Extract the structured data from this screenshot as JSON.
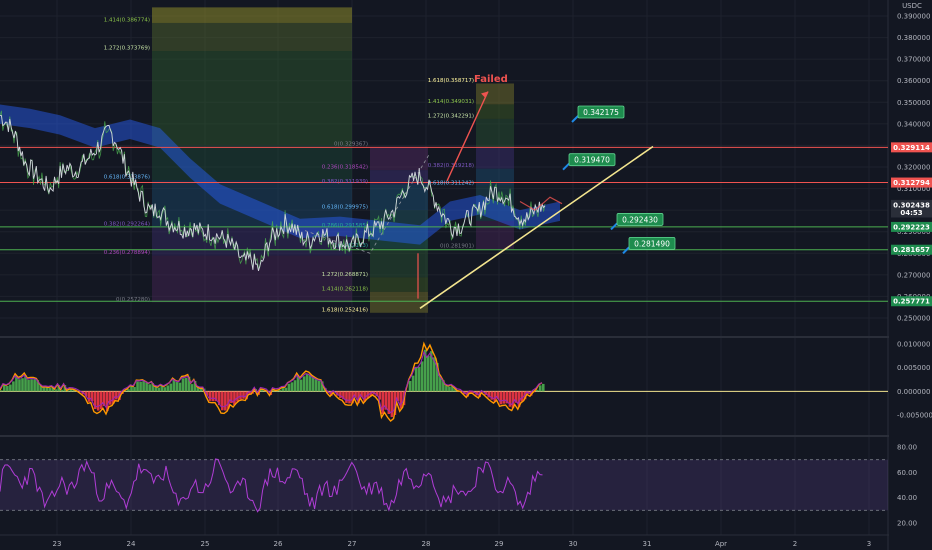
{
  "currency": "USDC",
  "colors": {
    "background": "#131722",
    "red_line": "#ef5350",
    "green_line": "#4caf50",
    "yellow_line": "#f3e58f",
    "purple_rsi": "#b03dd6",
    "macd_orange": "#ff9800",
    "macd_purple": "#9c27b0",
    "cloud_blue": "#2962ff",
    "callout_green": "#1e8c4e"
  },
  "price_axis": {
    "ticks": [
      "0.390000",
      "0.380000",
      "0.370000",
      "0.360000",
      "0.350000",
      "0.340000",
      "0.330000",
      "0.320000",
      "0.310000",
      "0.300000",
      "0.290000",
      "0.280000",
      "0.270000",
      "0.260000",
      "0.250000"
    ],
    "range": [
      0.247,
      0.3935
    ]
  },
  "price_labels": [
    {
      "text": "0.329114",
      "price": 0.329114,
      "color": "#ef5350"
    },
    {
      "text": "0.312794",
      "price": 0.312794,
      "color": "#ef5350"
    },
    {
      "text": "0.302438",
      "price": 0.302438,
      "color": "#2a2e39"
    },
    {
      "text": "04:53",
      "price": 0.2989,
      "color": "#2a2e39"
    },
    {
      "text": "0.292223",
      "price": 0.292223,
      "color": "#1e8c4e"
    },
    {
      "text": "0.281657",
      "price": 0.281657,
      "color": "#1e8c4e"
    },
    {
      "text": "0.257771",
      "price": 0.257771,
      "color": "#1e8c4e"
    }
  ],
  "horizontal_lines": [
    {
      "price": 0.329114,
      "color": "#ef5350"
    },
    {
      "price": 0.312794,
      "color": "#ef5350"
    },
    {
      "price": 0.292223,
      "color": "#4caf50"
    },
    {
      "price": 0.281657,
      "color": "#4caf50"
    },
    {
      "price": 0.257771,
      "color": "#4caf50"
    }
  ],
  "callouts": [
    {
      "text": "0.342175",
      "price": 0.3455
    },
    {
      "text": "0.319470",
      "price": 0.3234
    },
    {
      "text": "0.292430",
      "price": 0.2957
    },
    {
      "text": "0.281490",
      "price": 0.2846
    }
  ],
  "annotation_failed": "Failed",
  "fib_labels_left": [
    {
      "text": "1.414(0.386774)",
      "price": 0.386774,
      "color": "#8bc34a"
    },
    {
      "text": "1.272(0.373769)",
      "price": 0.373769,
      "color": "#c5e1a5"
    },
    {
      "text": "0.618(0.313876)",
      "price": 0.313876,
      "color": "#64b5f6"
    },
    {
      "text": "0.382(0.292264)",
      "price": 0.292264,
      "color": "#7e57c2"
    },
    {
      "text": "0.236(0.278894)",
      "price": 0.278894,
      "color": "#ab47bc"
    },
    {
      "text": "0(0.257280)",
      "price": 0.25728,
      "color": "#787b86"
    }
  ],
  "fib_labels_mid": [
    {
      "text": "0(0.329367)",
      "price": 0.329367,
      "color": "#787b86"
    },
    {
      "text": "0.236(0.318542)",
      "price": 0.318542,
      "color": "#ab47bc"
    },
    {
      "text": "0.382(0.311939)",
      "price": 0.311939,
      "color": "#7e57c2"
    },
    {
      "text": "0.618(0.299975)",
      "price": 0.299975,
      "color": "#64b5f6"
    },
    {
      "text": "0.786(0.291585)",
      "price": 0.291585,
      "color": "#26a69a"
    },
    {
      "text": "1(0.282113)",
      "price": 0.282113,
      "color": "#26a69a"
    },
    {
      "text": "1.272(0.268871)",
      "price": 0.268871,
      "color": "#c5e1a5"
    },
    {
      "text": "1.414(0.262118)",
      "price": 0.262118,
      "color": "#8bc34a"
    },
    {
      "text": "1.618(0.252416)",
      "price": 0.252416,
      "color": "#fff59d"
    }
  ],
  "fib_labels_right": [
    {
      "text": "1.618(0.358717)",
      "price": 0.358717,
      "color": "#fff59d"
    },
    {
      "text": "1.414(0.349031)",
      "price": 0.349031,
      "color": "#8bc34a"
    },
    {
      "text": "1.272(0.342291)",
      "price": 0.342291,
      "color": "#c5e1a5"
    },
    {
      "text": "0.382(0.319218)",
      "price": 0.319218,
      "color": "#7e57c2"
    },
    {
      "text": "0.618(0.311242)",
      "price": 0.311242,
      "color": "#64b5f6"
    },
    {
      "text": "0(0.281901)",
      "price": 0.281901,
      "color": "#787b86"
    }
  ],
  "macd_axis": {
    "ticks": [
      "0.010000",
      "0.005000",
      "0.000000",
      "-0.005000"
    ],
    "range": [
      -0.0095,
      0.0115
    ]
  },
  "rsi_axis": {
    "ticks": [
      "80.00",
      "60.00",
      "40.00",
      "20.00"
    ],
    "range": [
      15,
      87
    ],
    "band": [
      30,
      70
    ]
  },
  "time_axis": {
    "labels": [
      "23",
      "24",
      "25",
      "26",
      "27",
      "28",
      "29",
      "30",
      "31",
      "Apr",
      "2",
      "3"
    ]
  },
  "chart_data": {
    "type": "line",
    "title": "",
    "xlabel": "",
    "ylabel": "USDC",
    "x_labels": [
      "23",
      "24",
      "25",
      "26",
      "27",
      "28",
      "29",
      "30",
      "31",
      "Apr",
      "2",
      "3"
    ],
    "ylim": [
      0.247,
      0.3935
    ],
    "series": [
      {
        "values": [
          0.344,
          0.34,
          0.333,
          0.322,
          0.318,
          0.313,
          0.31,
          0.316,
          0.32,
          0.318,
          0.322,
          0.326,
          0.331,
          0.337,
          0.331,
          0.32,
          0.312,
          0.305,
          0.299,
          0.301,
          0.295,
          0.293,
          0.291,
          0.292,
          0.29,
          0.29,
          0.288,
          0.286,
          0.282,
          0.276,
          0.277,
          0.272,
          0.285,
          0.29,
          0.294,
          0.292,
          0.287,
          0.286,
          0.29,
          0.288,
          0.286,
          0.285,
          0.283,
          0.287,
          0.29,
          0.292,
          0.296,
          0.3,
          0.308,
          0.313,
          0.316,
          0.311,
          0.304,
          0.297,
          0.292,
          0.293,
          0.297,
          0.299,
          0.305,
          0.309,
          0.307,
          0.303,
          0.297,
          0.296,
          0.301,
          0.302
        ]
      }
    ],
    "trendline_to_price": 0.3295,
    "grid": true
  }
}
